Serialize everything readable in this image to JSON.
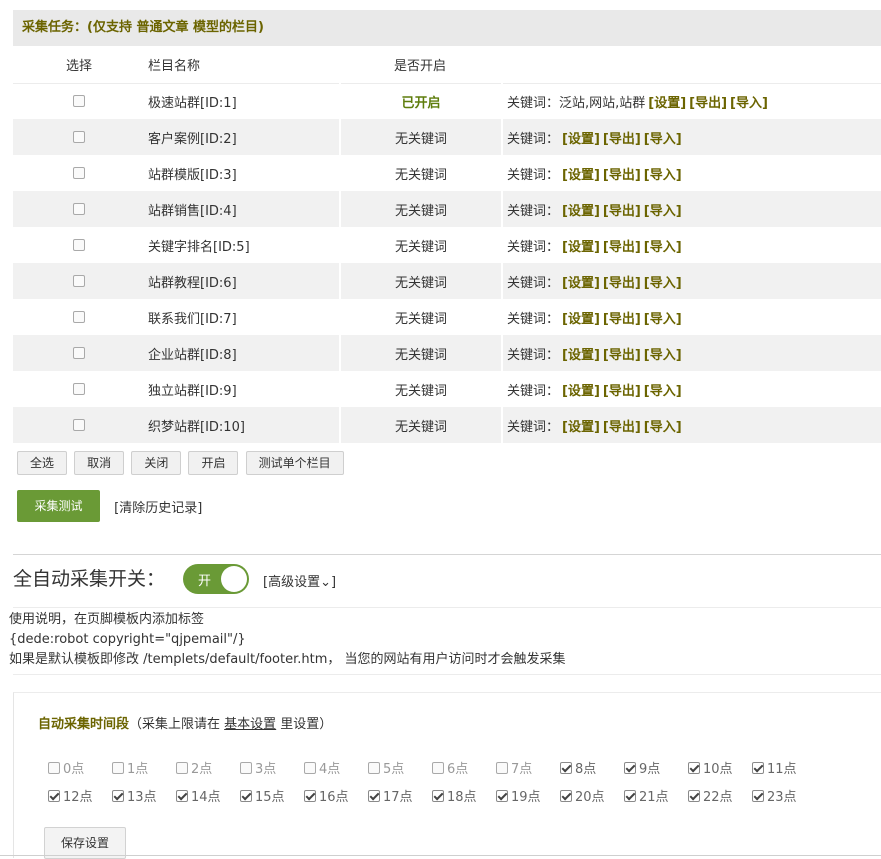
{
  "task_header": "采集任务：(仅支持 普通文章 模型的栏目)",
  "columns": {
    "select": "选择",
    "name": "栏目名称",
    "enabled": "是否开启"
  },
  "rows": [
    {
      "name": "极速站群[ID:1]",
      "state": "已开启",
      "state_on": true,
      "kw_label": "关键词：泛站,网站,站群",
      "set": "[设置]",
      "export": "[导出]",
      "import": "[导入]"
    },
    {
      "name": "客户案例[ID:2]",
      "state": "无关键词",
      "state_on": false,
      "kw_label": "关键词：",
      "set": "[设置]",
      "export": "[导出]",
      "import": "[导入]"
    },
    {
      "name": "站群模版[ID:3]",
      "state": "无关键词",
      "state_on": false,
      "kw_label": "关键词：",
      "set": "[设置]",
      "export": "[导出]",
      "import": "[导入]"
    },
    {
      "name": "站群销售[ID:4]",
      "state": "无关键词",
      "state_on": false,
      "kw_label": "关键词：",
      "set": "[设置]",
      "export": "[导出]",
      "import": "[导入]"
    },
    {
      "name": "关键字排名[ID:5]",
      "state": "无关键词",
      "state_on": false,
      "kw_label": "关键词：",
      "set": "[设置]",
      "export": "[导出]",
      "import": "[导入]"
    },
    {
      "name": "站群教程[ID:6]",
      "state": "无关键词",
      "state_on": false,
      "kw_label": "关键词：",
      "set": "[设置]",
      "export": "[导出]",
      "import": "[导入]"
    },
    {
      "name": "联系我们[ID:7]",
      "state": "无关键词",
      "state_on": false,
      "kw_label": "关键词：",
      "set": "[设置]",
      "export": "[导出]",
      "import": "[导入]"
    },
    {
      "name": "企业站群[ID:8]",
      "state": "无关键词",
      "state_on": false,
      "kw_label": "关键词：",
      "set": "[设置]",
      "export": "[导出]",
      "import": "[导入]"
    },
    {
      "name": "独立站群[ID:9]",
      "state": "无关键词",
      "state_on": false,
      "kw_label": "关键词：",
      "set": "[设置]",
      "export": "[导出]",
      "import": "[导入]"
    },
    {
      "name": "织梦站群[ID:10]",
      "state": "无关键词",
      "state_on": false,
      "kw_label": "关键词：",
      "set": "[设置]",
      "export": "[导出]",
      "import": "[导入]"
    }
  ],
  "buttons": {
    "select_all": "全选",
    "cancel": "取消",
    "close": "关闭",
    "open": "开启",
    "test_single": "测试单个栏目"
  },
  "collect_test": "采集测试",
  "clear_history": "[清除历史记录]",
  "auto": {
    "title": "全自动采集开关：",
    "toggle_label": "开",
    "advanced": "[高级设置⌄]"
  },
  "usage": {
    "line1": "使用说明，在页脚模板内添加标签",
    "line2": "{dede:robot copyright=\"qjpemail\"/}",
    "line3": "如果是默认模板即修改 /templets/default/footer.htm， 当您的网站有用户访问时才会触发采集"
  },
  "time": {
    "title_strong": "自动采集时间段",
    "title_pre": "（采集上限请在 ",
    "title_link": "基本设置",
    "title_post": " 里设置）",
    "hours": [
      {
        "label": "0点",
        "checked": false
      },
      {
        "label": "1点",
        "checked": false
      },
      {
        "label": "2点",
        "checked": false
      },
      {
        "label": "3点",
        "checked": false
      },
      {
        "label": "4点",
        "checked": false
      },
      {
        "label": "5点",
        "checked": false
      },
      {
        "label": "6点",
        "checked": false
      },
      {
        "label": "7点",
        "checked": false
      },
      {
        "label": "8点",
        "checked": true
      },
      {
        "label": "9点",
        "checked": true
      },
      {
        "label": "10点",
        "checked": true
      },
      {
        "label": "11点",
        "checked": true
      },
      {
        "label": "12点",
        "checked": true
      },
      {
        "label": "13点",
        "checked": true
      },
      {
        "label": "14点",
        "checked": true
      },
      {
        "label": "15点",
        "checked": true
      },
      {
        "label": "16点",
        "checked": true
      },
      {
        "label": "17点",
        "checked": true
      },
      {
        "label": "18点",
        "checked": true
      },
      {
        "label": "19点",
        "checked": true
      },
      {
        "label": "20点",
        "checked": true
      },
      {
        "label": "21点",
        "checked": true
      },
      {
        "label": "22点",
        "checked": true
      },
      {
        "label": "23点",
        "checked": true
      }
    ],
    "save": "保存设置"
  },
  "colors": {
    "accent_green": "#6a9a36",
    "olive_text": "#6b6400",
    "state_on": "#5e7d0c"
  }
}
